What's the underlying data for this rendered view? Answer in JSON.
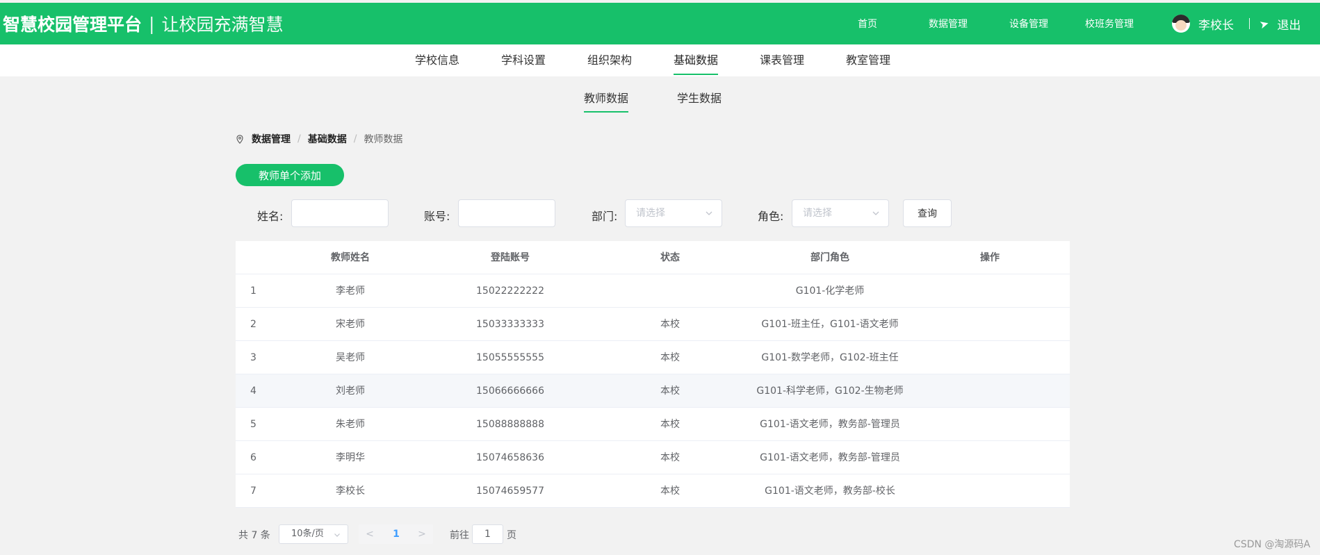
{
  "header": {
    "app_name": "智慧校园管理平台",
    "separator": "|",
    "slogan": "让校园充满智慧",
    "nav": [
      "首页",
      "数据管理",
      "设备管理",
      "校班务管理"
    ],
    "user_name": "李校长",
    "logout_label": "退出"
  },
  "subnav": {
    "items": [
      "学校信息",
      "学科设置",
      "组织架构",
      "基础数据",
      "课表管理",
      "教室管理"
    ],
    "active": "基础数据"
  },
  "tabs": {
    "items": [
      "教师数据",
      "学生数据"
    ],
    "active": "教师数据"
  },
  "breadcrumb": [
    "数据管理",
    "基础数据",
    "教师数据"
  ],
  "add_button": "教师单个添加",
  "filters": {
    "name_label": "姓名:",
    "name_value": "",
    "account_label": "账号:",
    "account_value": "",
    "dept_label": "部门:",
    "dept_placeholder": "请选择",
    "role_label": "角色:",
    "role_placeholder": "请选择",
    "query_button": "查询"
  },
  "table": {
    "columns": [
      "教师姓名",
      "登陆账号",
      "状态",
      "部门角色",
      "操作"
    ],
    "rows": [
      {
        "index": "1",
        "name": "李老师",
        "account": "15022222222",
        "status": "",
        "role": "G101-化学老师",
        "op": ""
      },
      {
        "index": "2",
        "name": "宋老师",
        "account": "15033333333",
        "status": "本校",
        "role": "G101-班主任，G101-语文老师",
        "op": ""
      },
      {
        "index": "3",
        "name": "吴老师",
        "account": "15055555555",
        "status": "本校",
        "role": "G101-数学老师，G102-班主任",
        "op": ""
      },
      {
        "index": "4",
        "name": "刘老师",
        "account": "15066666666",
        "status": "本校",
        "role": "G101-科学老师，G102-生物老师",
        "op": ""
      },
      {
        "index": "5",
        "name": "朱老师",
        "account": "15088888888",
        "status": "本校",
        "role": "G101-语文老师，教务部-管理员",
        "op": ""
      },
      {
        "index": "6",
        "name": "李明华",
        "account": "15074658636",
        "status": "本校",
        "role": "G101-语文老师，教务部-管理员",
        "op": ""
      },
      {
        "index": "7",
        "name": "李校长",
        "account": "15074659577",
        "status": "本校",
        "role": "G101-语文老师，教务部-校长",
        "op": ""
      }
    ]
  },
  "pagination": {
    "total": "共 7 条",
    "page_size": "10条/页",
    "prev": "<",
    "current_page": "1",
    "next": ">",
    "goto_label": "前往",
    "goto_value": "1",
    "page_unit": "页"
  },
  "watermark": "CSDN @淘源码A",
  "colors": {
    "accent": "#17c06a",
    "link": "#409eff"
  }
}
